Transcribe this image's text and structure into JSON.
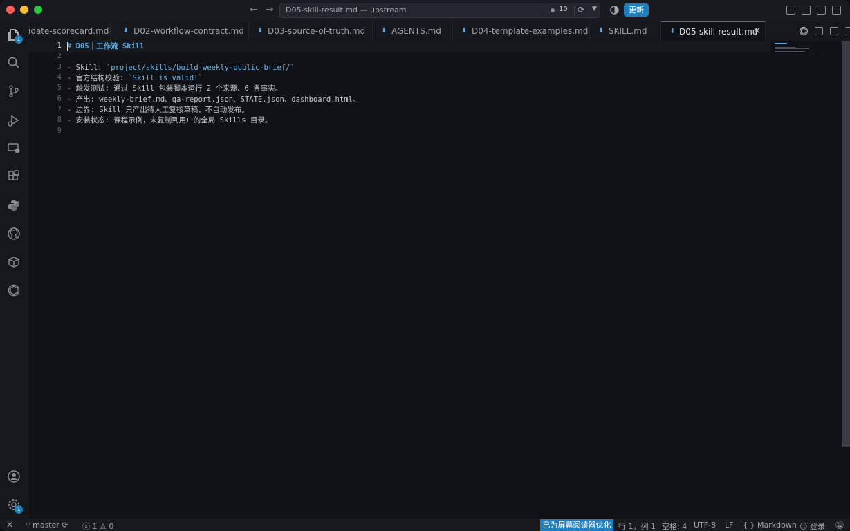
{
  "titlebar": {
    "command_center_title": "D05-skill-result.md — upstream",
    "changes_count": "10",
    "update_label": "更新"
  },
  "activity": {
    "explorer_badge": "1",
    "settings_badge": "1"
  },
  "tabs": [
    {
      "label": "idate-scorecard.md"
    },
    {
      "label": "D02-workflow-contract.md"
    },
    {
      "label": "D03-source-of-truth.md"
    },
    {
      "label": "AGENTS.md"
    },
    {
      "label": "D04-template-examples.md"
    },
    {
      "label": "SKILL.md"
    },
    {
      "label": "D05-skill-result.md"
    }
  ],
  "editor": {
    "line_numbers": [
      "1",
      "2",
      "3",
      "4",
      "5",
      "6",
      "7",
      "8",
      "9"
    ],
    "line1_heading": "D05｜工作流 Skill",
    "line3_text": "Skill: ",
    "line3_code": "`project/skills/build-weekly-public-brief/`",
    "line4_text": "官方结构校验: ",
    "line4_code": "`Skill is valid!`",
    "line5_text": "触发测试: 通过 Skill 包装脚本运行 2 个来源、6 条事实。",
    "line6_text": "产出: weekly-brief.md、qa-report.json、STATE.json、dashboard.html。",
    "line7_text": "边界: Skill 只产出待人工复核草稿，不自动发布。",
    "line8_text": "安装状态: 课程示例，未复制到用户的全局 Skills 目录。"
  },
  "statusbar": {
    "branch": "master",
    "errors": "1",
    "warnings": "0",
    "screen_reader": "已为屏幕阅读器优化",
    "position": "行 1，列 1",
    "spaces": "空格: 4",
    "encoding": "UTF-8",
    "eol": "LF",
    "language": "Markdown",
    "login": "登录"
  },
  "colors": {
    "accent": "#1c7fbf",
    "heading": "#58a8e6",
    "list_marker": "#e8823a",
    "inline_code": "#6fb6ee"
  }
}
